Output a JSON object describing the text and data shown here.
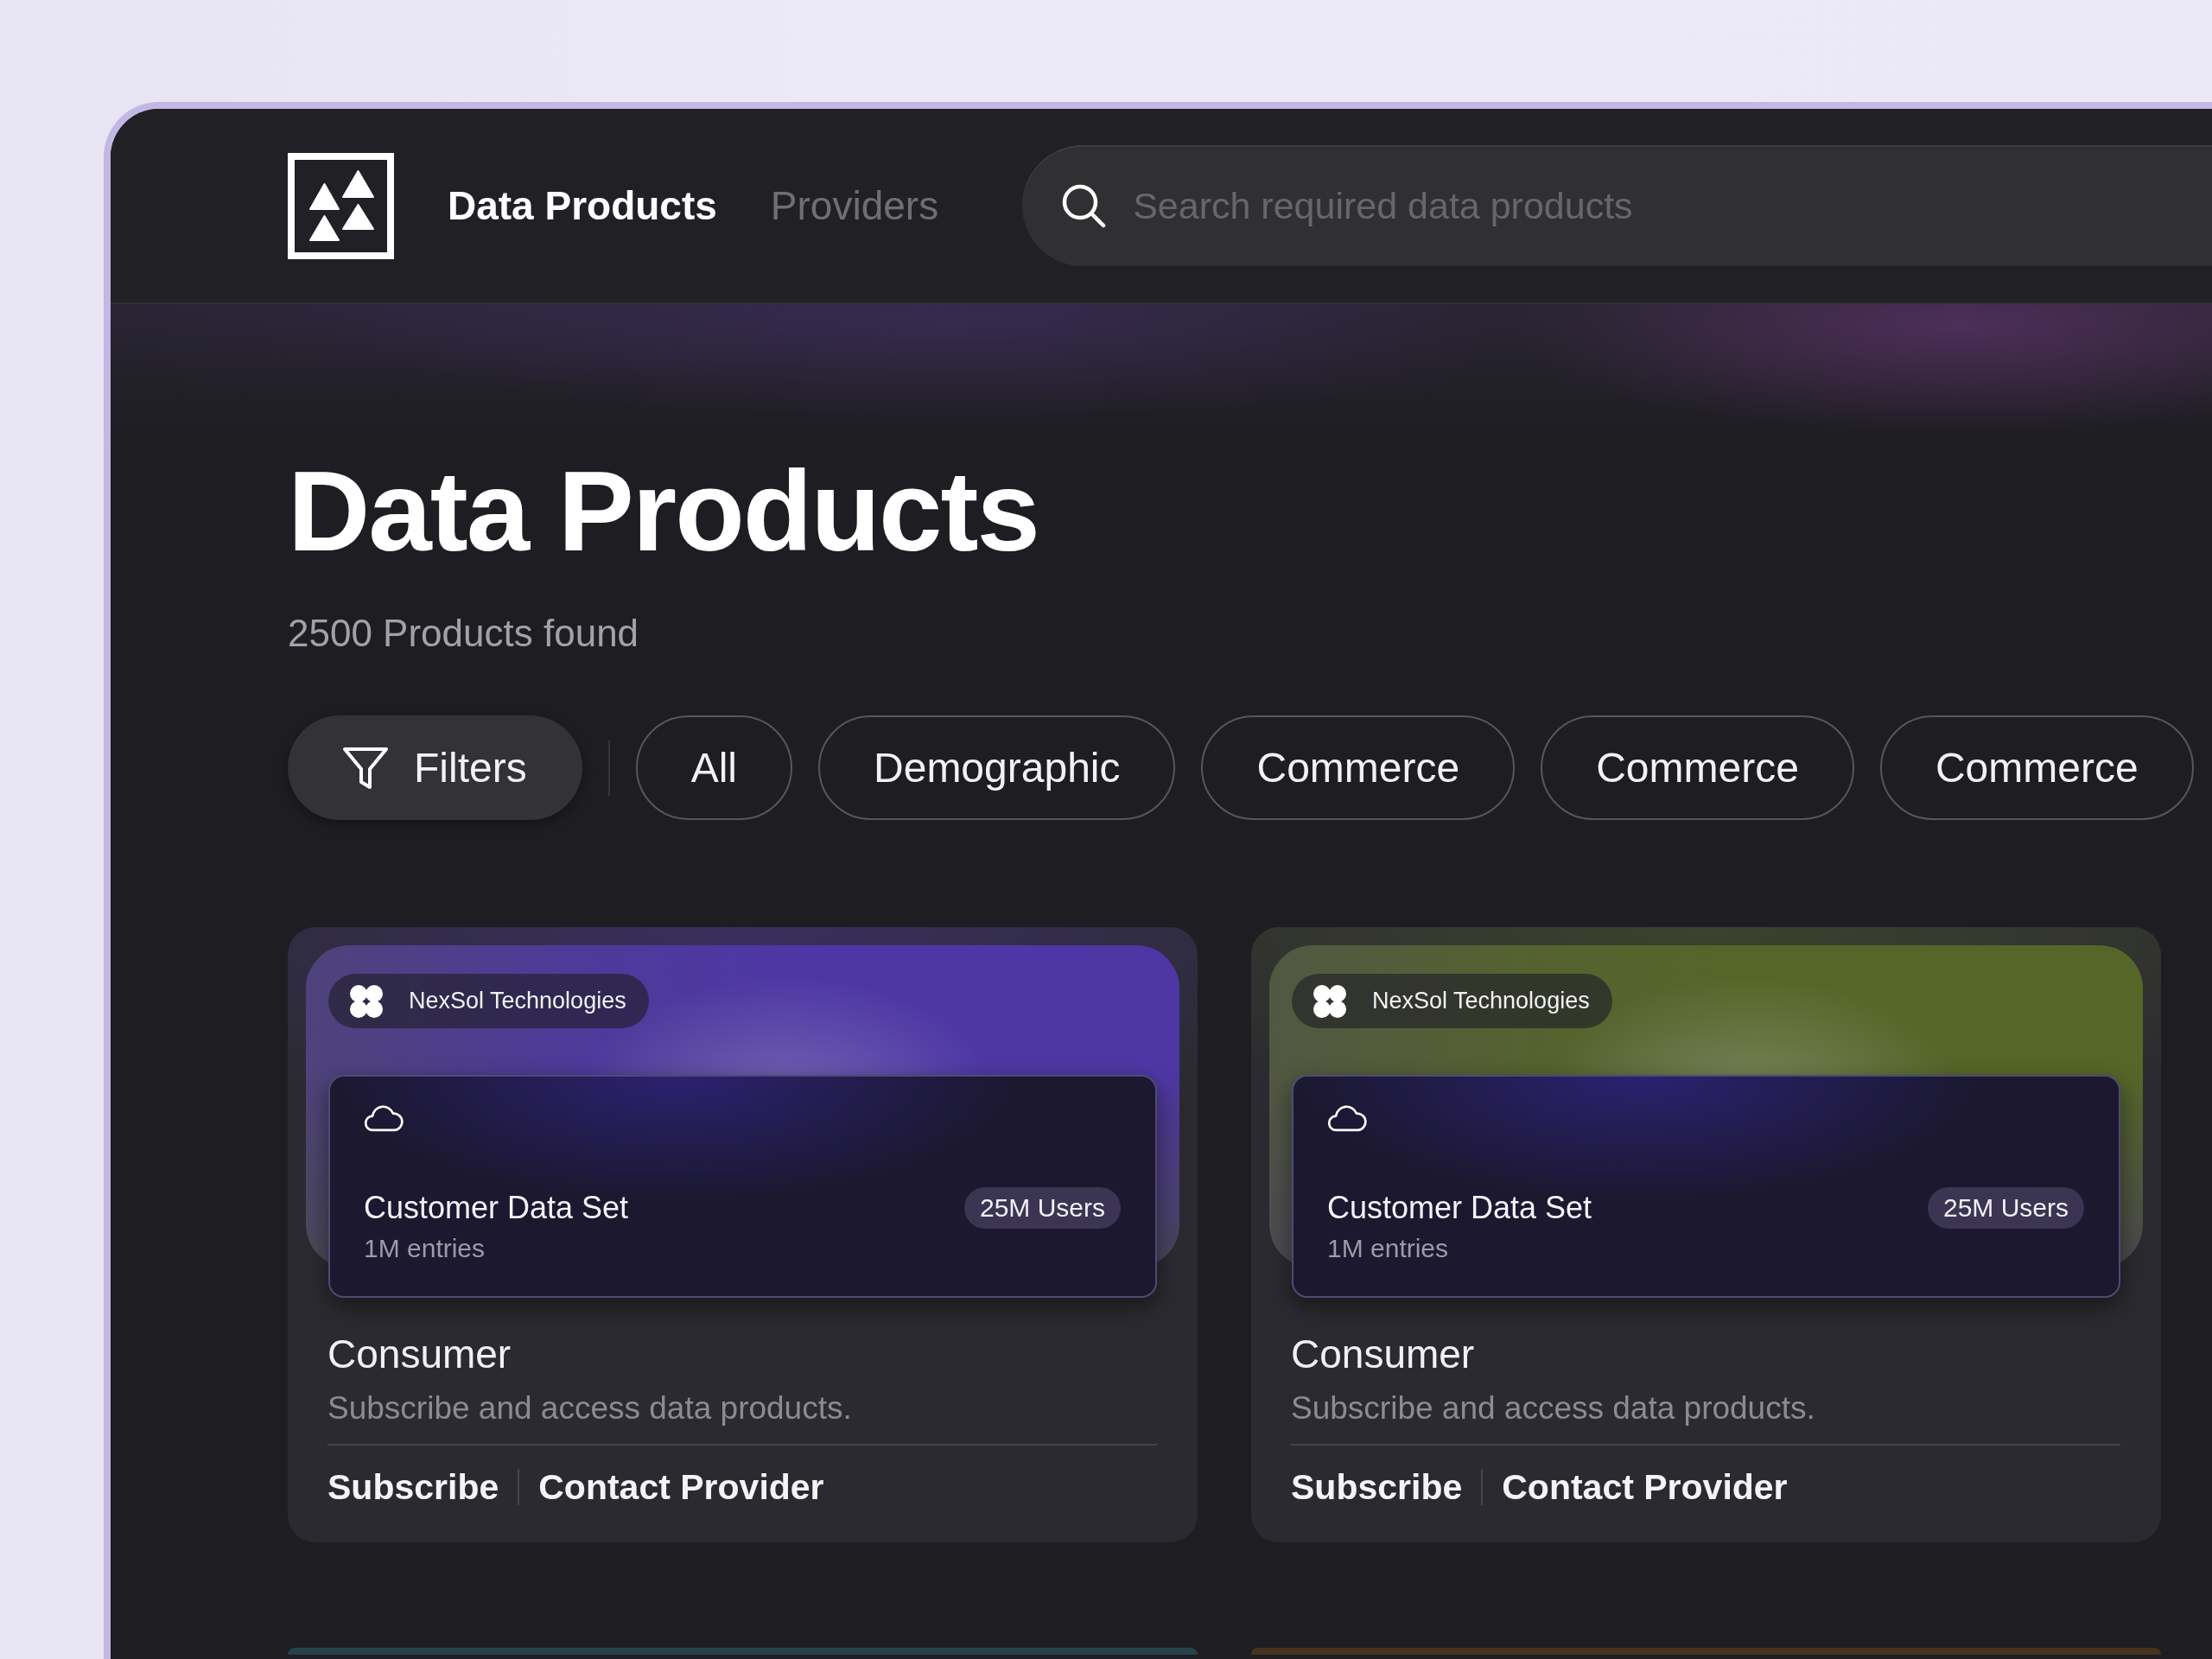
{
  "nav": [
    {
      "label": "Data Products",
      "selected": true
    },
    {
      "label": "Providers",
      "selected": false
    }
  ],
  "search": {
    "placeholder": "Search required data products"
  },
  "heading": {
    "title": "Data Products",
    "count": "2500 Products found"
  },
  "filters": {
    "button": "Filters",
    "chips": [
      {
        "label": "All",
        "selected": false
      },
      {
        "label": "Demographic",
        "selected": false
      },
      {
        "label": "Commerce",
        "selected": false
      },
      {
        "label": "Commerce",
        "selected": false
      },
      {
        "label": "Commerce",
        "selected": false
      }
    ]
  },
  "cards": [
    {
      "color": "#4e37a4",
      "provider": "NexSol Technologies",
      "dataset": {
        "name": "Customer Data Set",
        "entries": "1M entries",
        "badge": "25M Users"
      },
      "title": "Consumer",
      "description": "Subscribe and access data products.",
      "actions": [
        "Subscribe",
        "Contact Provider"
      ]
    },
    {
      "color": "#566629",
      "provider": "NexSol Technologies",
      "dataset": {
        "name": "Customer Data Set",
        "entries": "1M entries",
        "badge": "25M Users"
      },
      "title": "Consumer",
      "description": "Subscribe and access data products.",
      "actions": [
        "Subscribe",
        "Contact Provider"
      ]
    }
  ],
  "next_cards": [
    {
      "color": "#24434b"
    },
    {
      "color": "#45331f"
    }
  ]
}
